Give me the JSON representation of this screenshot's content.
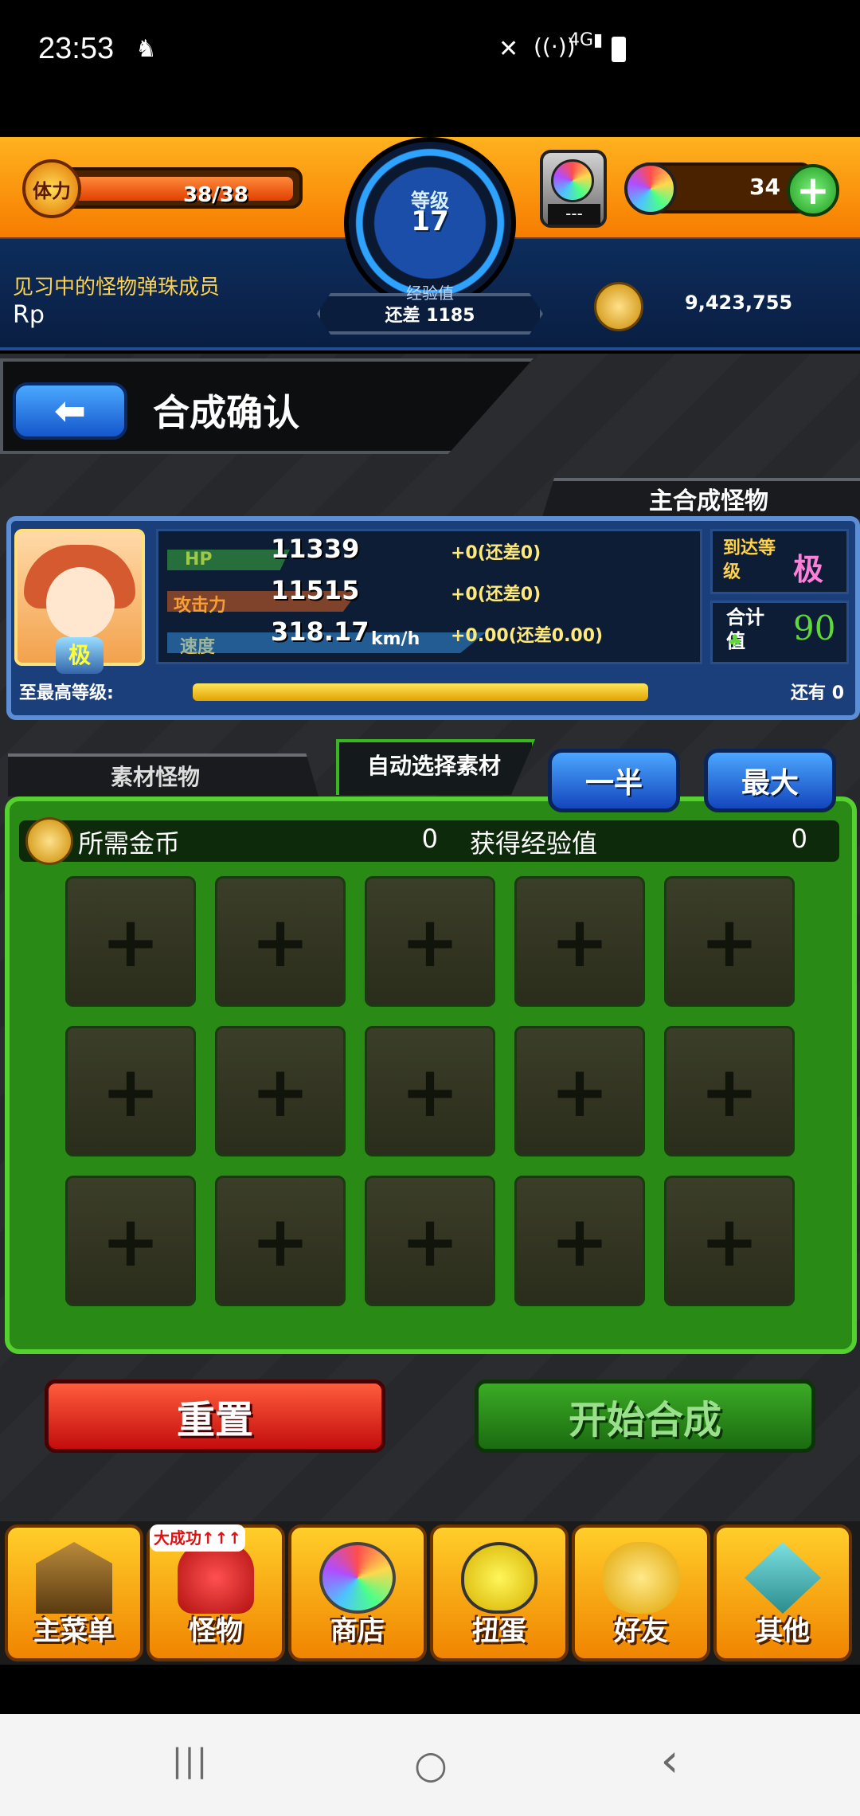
{
  "status_bar": {
    "time": "23:53",
    "icons": [
      "notification-icon",
      "mute-icon",
      "wifi-icon",
      "signal-4g-icon",
      "battery-icon"
    ]
  },
  "hud": {
    "stamina_label": "体力",
    "stamina_value": "38/38",
    "stamina_fraction": 1.0,
    "level_label": "等级",
    "level_value": "17",
    "exp_label": "经验值",
    "exp_remaining": "还差 1185",
    "gem_pod_text": "---",
    "orb_count": "34",
    "player_title": "见习中的怪物弹珠成员",
    "player_name": "Rp",
    "gold": "9,423,755"
  },
  "screen": {
    "title": "合成确认",
    "main_tab_label": "主合成怪物"
  },
  "monster": {
    "portrait_badge": "极",
    "stats": [
      {
        "label": "HP",
        "value": "11339",
        "bonus": "+0(还差0)",
        "color": "#3fbf3f"
      },
      {
        "label": "攻击力",
        "value": "11515",
        "bonus": "+0(还差0)",
        "color": "#ef6a1d"
      },
      {
        "label": "速度",
        "value": "318.17",
        "unit": "km/h",
        "bonus": "+0.00(还差0.00)",
        "color": "#3a9af0"
      }
    ],
    "reach_label": "到达等级",
    "reach_value": "极",
    "total_label": "合计值",
    "total_value": "90",
    "maxlv_label": "至最高等级:",
    "maxlv_fraction": 1.0,
    "remain_label": "还有 0"
  },
  "material": {
    "tab_material": "素材怪物",
    "tab_auto": "自动选择素材",
    "half_button": "一半",
    "max_button": "最大",
    "cost_label": "所需金币",
    "cost_value": "0",
    "exp_gain_label": "获得经验值",
    "exp_gain_value": "0",
    "slot_symbol": "+",
    "slot_count": 15
  },
  "actions": {
    "reset": "重置",
    "start": "开始合成"
  },
  "bottom_nav": [
    {
      "id": "main-menu",
      "label": "主菜单",
      "icon": "gate-icon"
    },
    {
      "id": "monster",
      "label": "怪物",
      "icon": "monster-icon",
      "badge": "大成功↑↑↑"
    },
    {
      "id": "shop",
      "label": "商店",
      "icon": "rainbow-orb-icon"
    },
    {
      "id": "gacha",
      "label": "扭蛋",
      "icon": "egg-icon"
    },
    {
      "id": "friends",
      "label": "好友",
      "icon": "friends-icon"
    },
    {
      "id": "other",
      "label": "其他",
      "icon": "other-icon"
    }
  ],
  "android_nav": {
    "recents": "|||",
    "home": "○",
    "back": "‹"
  }
}
